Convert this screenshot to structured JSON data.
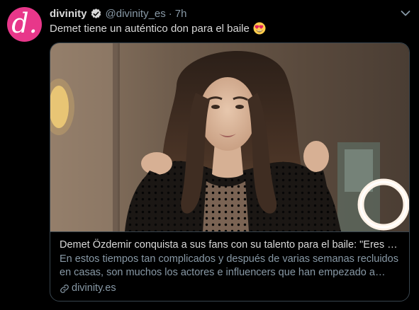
{
  "tweet": {
    "avatar_letter": "d.",
    "display_name": "divinity",
    "handle": "@divinity_es",
    "separator": "·",
    "time": "7h",
    "text": "Demet tiene un auténtico don para el baile",
    "emoji": "smiling-face-with-heart-eyes-emoji"
  },
  "card": {
    "title": "Demet Özdemir conquista a sus fans con su talento para el baile: \"Eres …",
    "description": "En estos tiempos tan complicados y después de varias semanas recluidos en casas, son muchos los actores e influencers que han empezado a tira…",
    "domain": "divinity.es"
  },
  "colors": {
    "background": "#000000",
    "text": "#d9d9d9",
    "secondary": "#8899a6",
    "border": "#38444d",
    "brand": "#e8378a",
    "verified": "#d9d9d9"
  }
}
